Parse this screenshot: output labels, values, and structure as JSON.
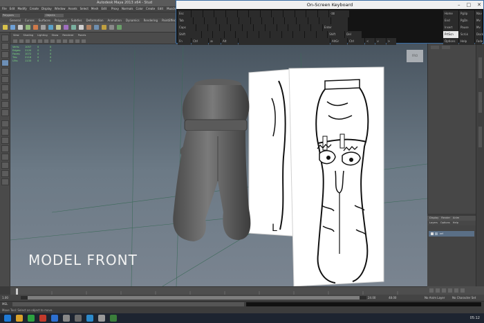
{
  "app": {
    "title": "Autodesk Maya 2013 x64 - Stud",
    "menu": [
      "File",
      "Edit",
      "Modify",
      "Create",
      "Display",
      "Window",
      "Assets",
      "Select",
      "Mesh",
      "Edit Mesh",
      "Proxy",
      "Normals",
      "Color",
      "Create UVs",
      "Edit UVs",
      "Muscle"
    ],
    "mode": "Polygons",
    "objects_label": "Objects",
    "shelf_tabs": [
      "General",
      "Curves",
      "Surfaces",
      "Polygons",
      "Subdivs",
      "Deformation",
      "Animation",
      "Dynamics",
      "Rendering",
      "PaintEffects"
    ]
  },
  "viewport": {
    "panel_menu": [
      "View",
      "Shading",
      "Lighting",
      "Show",
      "Renderer",
      "Panels"
    ],
    "hud": [
      [
        "Verts:",
        "1057",
        "0",
        "0"
      ],
      [
        "Edges:",
        "2120",
        "0",
        "0"
      ],
      [
        "Faces:",
        "1072",
        "0",
        "0"
      ],
      [
        "Tris:",
        "2116",
        "0",
        "0"
      ],
      [
        "UVs:",
        "1133",
        "0",
        "0"
      ]
    ],
    "overlay_text": "MODEL FRONT",
    "viewcube_label": "FRO",
    "ref_letter": "L"
  },
  "keyboard": {
    "title": "On-Screen Keyboard",
    "rows": [
      [
        "Esc",
        "",
        "",
        "",
        "",
        "",
        "",
        "",
        "",
        "",
        "",
        "",
        "",
        "⌫"
      ],
      [
        "Tab",
        "",
        "",
        "",
        "",
        "",
        "",
        "",
        "",
        "",
        "",
        "",
        "",
        ""
      ],
      [
        "Caps",
        "",
        "",
        "",
        "",
        "",
        "",
        "",
        "",
        "",
        "",
        "",
        "Enter"
      ],
      [
        "Shift",
        "",
        "",
        "",
        "",
        "",
        "",
        "",
        "",
        "",
        "",
        "",
        "Shift",
        "Del"
      ],
      [
        "Fn",
        "Ctrl",
        "⊞",
        "Alt",
        "",
        "AltGr",
        "Ctrl",
        "<",
        "v",
        ">"
      ]
    ],
    "side_keys": [
      [
        "Home",
        "PgUp",
        "Nav"
      ],
      [
        "End",
        "PgDn",
        "Mv Up"
      ],
      [
        "Insert",
        "Pause",
        "Mv Dn"
      ],
      [
        "PrtScn",
        "ScrLk",
        "Dock"
      ],
      [
        "Options",
        "Help",
        "Fade"
      ]
    ]
  },
  "layers": {
    "tabs": [
      "Display",
      "Render",
      "Anim"
    ],
    "menu": [
      "Layers",
      "Options",
      "Help"
    ],
    "layer_name": "ref"
  },
  "time": {
    "range_start": "1.00",
    "range_end": "24.00",
    "range_end2": "48.00",
    "anim_layer": "No Anim Layer",
    "char_set": "No Character Set",
    "mel_label": "MEL",
    "help_text": "Move Tool: Select an object to move."
  },
  "taskbar": {
    "clock": "05:12",
    "icon_colors": [
      "#1f7ad6",
      "#d9a12a",
      "#2da140",
      "#c23a2b",
      "#2d6fd0",
      "#888888",
      "#6a6a6a",
      "#2c8acb",
      "#999999",
      "#3b7e3b"
    ]
  }
}
